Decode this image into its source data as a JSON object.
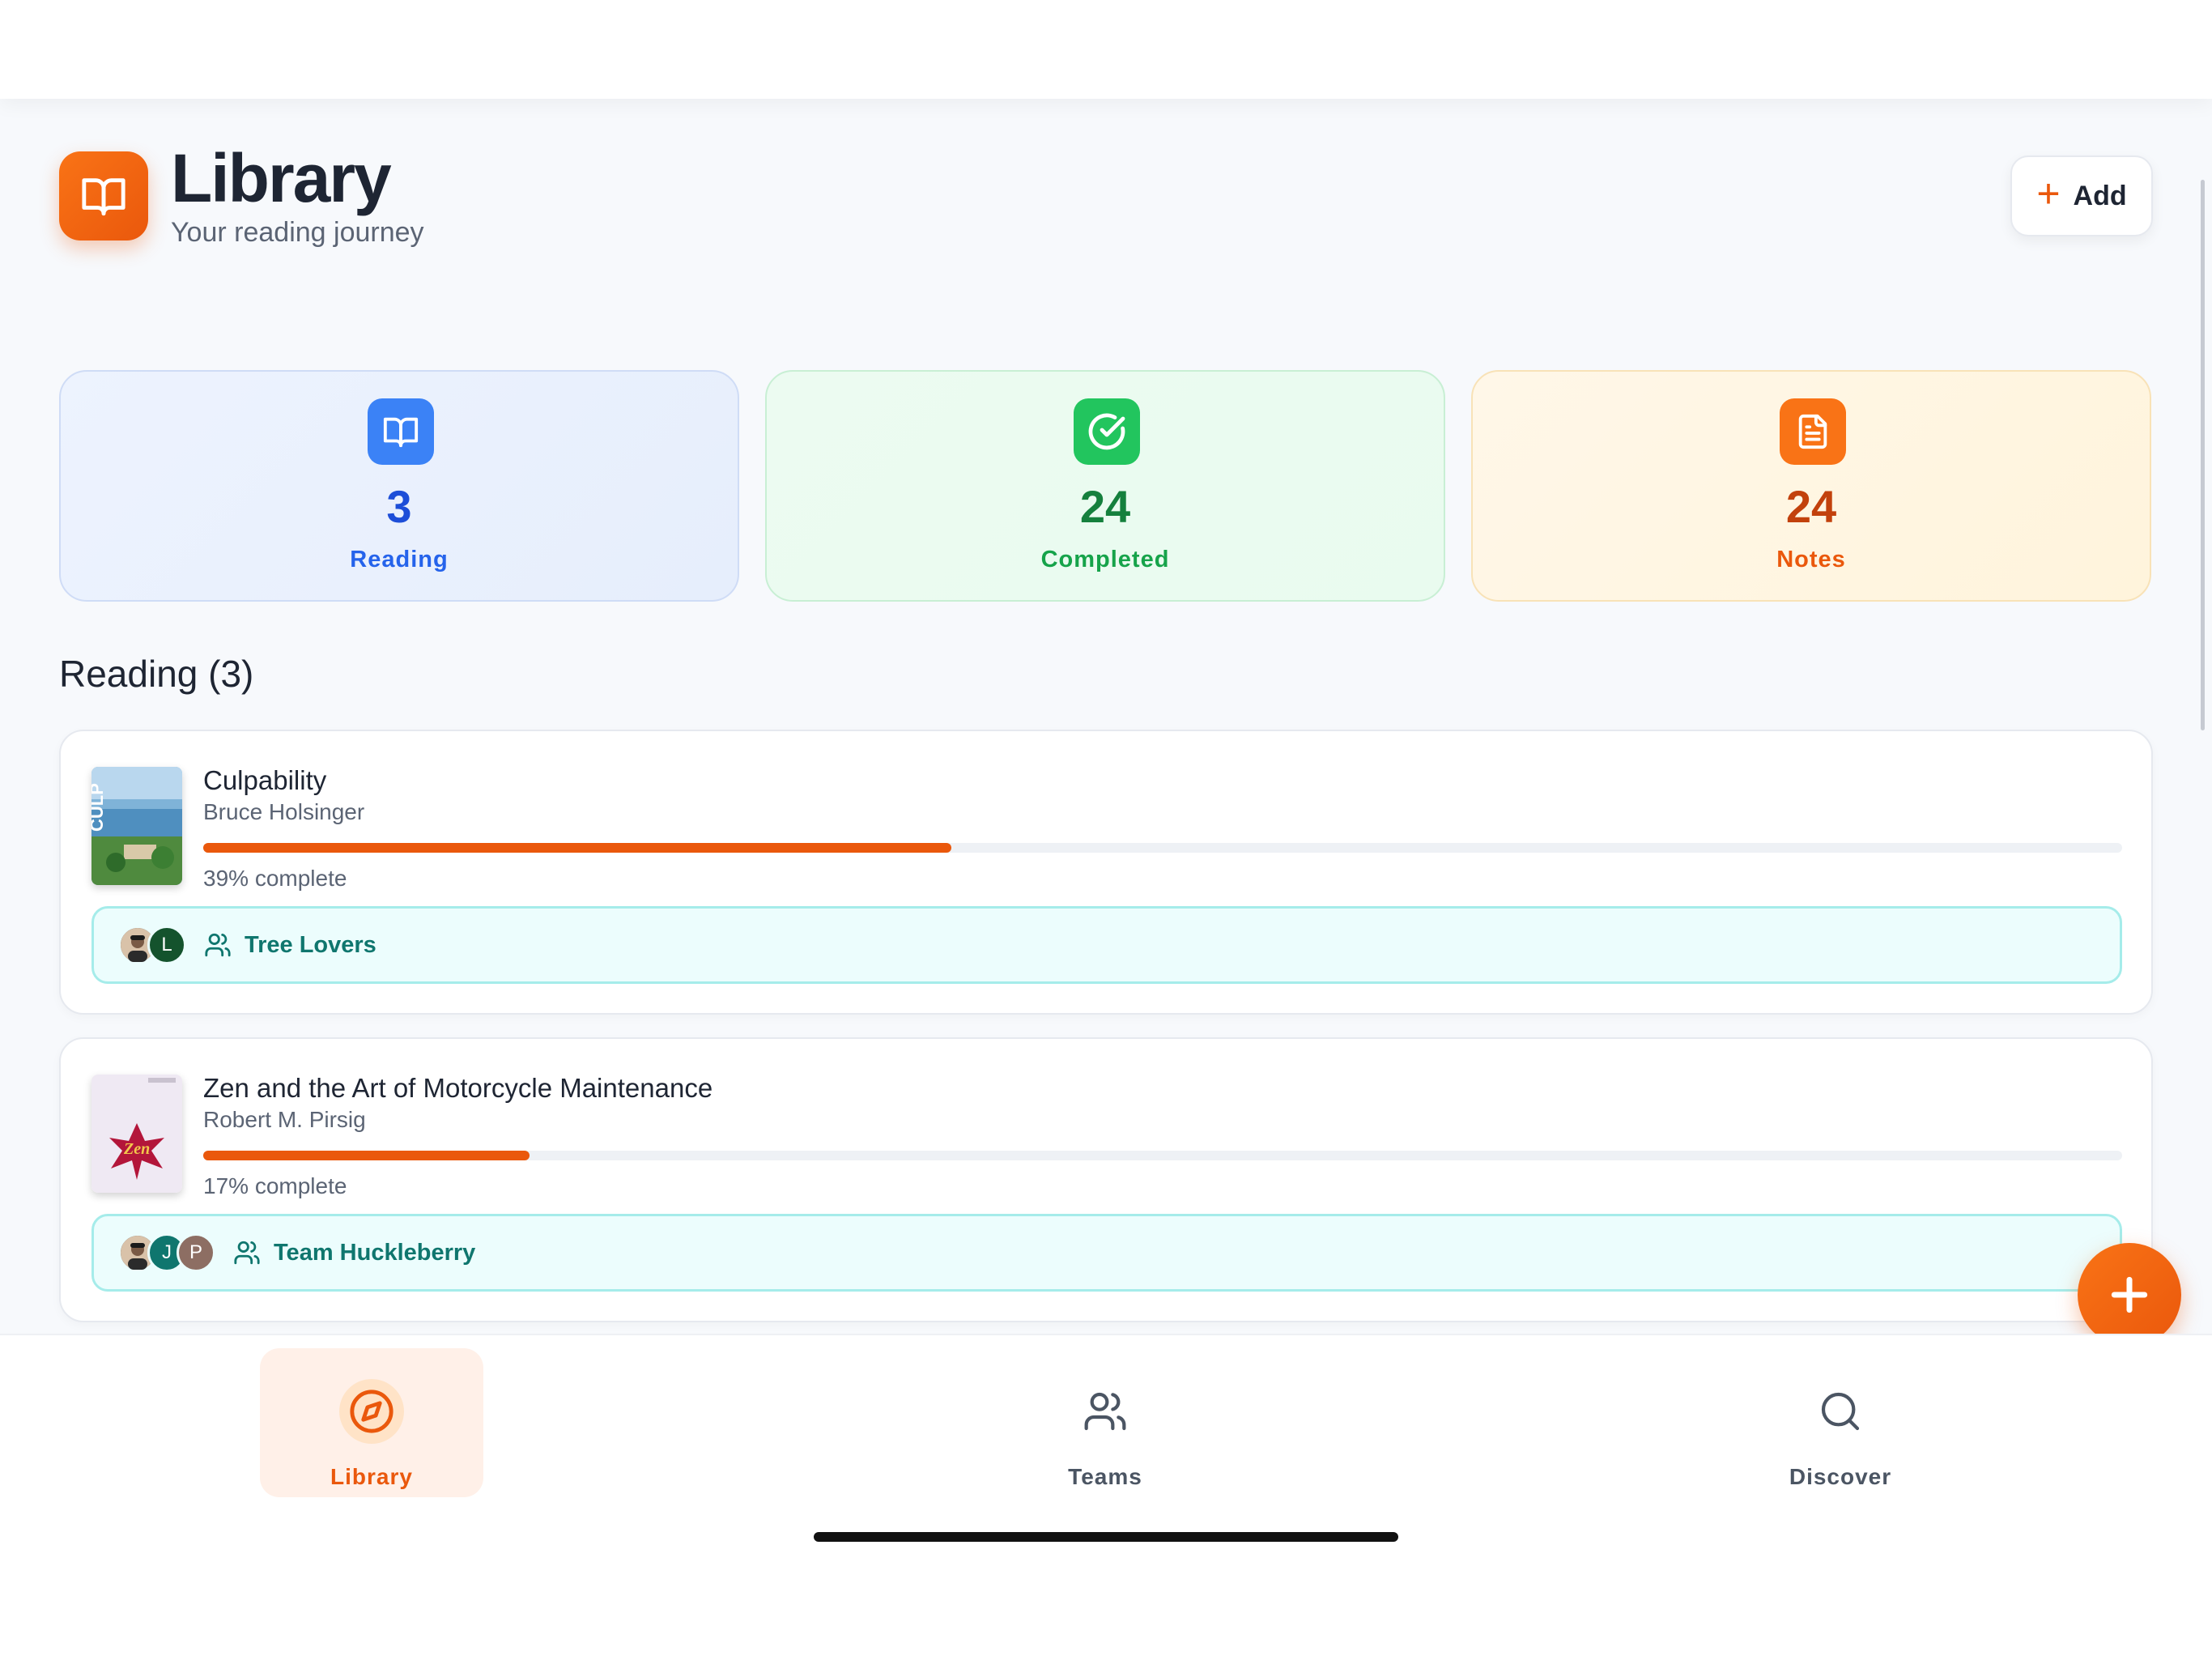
{
  "header": {
    "title": "Library",
    "subtitle": "Your reading journey",
    "add_label": "Add"
  },
  "stats": [
    {
      "value": "3",
      "label": "Reading",
      "color": "#1d4ed8",
      "icon": "open-book-icon",
      "accent": "#3b82f6"
    },
    {
      "value": "24",
      "label": "Completed",
      "color": "#15803d",
      "icon": "check-circle-icon",
      "accent": "#22c55e"
    },
    {
      "value": "24",
      "label": "Notes",
      "color": "#c2410c",
      "icon": "document-icon",
      "accent": "#f97316"
    }
  ],
  "section": {
    "title": "Reading (3)"
  },
  "books": [
    {
      "title": "Culpability",
      "author": "Bruce Holsinger",
      "progress": 39,
      "progress_label": "39% complete",
      "team": "Tree Lovers",
      "avatars": [
        "",
        "L"
      ]
    },
    {
      "title": "Zen and the Art of Motorcycle Maintenance",
      "author": "Robert M. Pirsig",
      "progress": 17,
      "progress_label": "17% complete",
      "team": "Team Huckleberry",
      "avatars": [
        "",
        "J",
        "P"
      ]
    }
  ],
  "nav": [
    {
      "label": "Library",
      "icon": "compass-icon",
      "active": true
    },
    {
      "label": "Teams",
      "icon": "users-icon",
      "active": false
    },
    {
      "label": "Discover",
      "icon": "search-icon",
      "active": false
    }
  ],
  "colors": {
    "accent": "#ea580c",
    "team_text": "#0f766e"
  }
}
